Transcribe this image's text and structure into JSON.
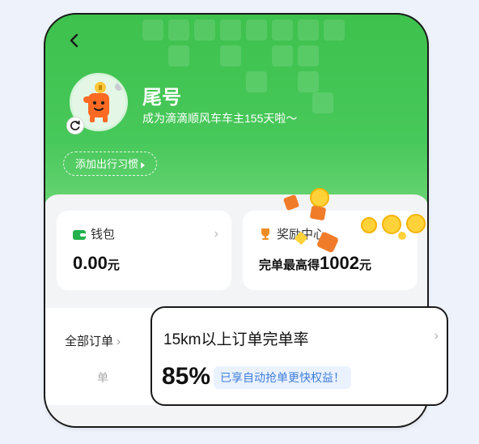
{
  "header": {
    "name": "尾号",
    "subtitle": "成为滴滴顺风车车主155天啦～",
    "habit_button": "添加出行习惯"
  },
  "wallet": {
    "title": "钱包",
    "amount": "0.00",
    "unit": "元"
  },
  "reward": {
    "title": "奖励中心",
    "prefix": "完单最高得",
    "amount": "1002",
    "unit": "元"
  },
  "orders": {
    "label": "全部订单",
    "faded_text": "单"
  },
  "popup": {
    "title": "15km以上订单完单率",
    "rate": "85%",
    "badge": "已享自动抢单更快权益！"
  },
  "colors": {
    "brand_green": "#3ec14d",
    "accent_blue": "#3f7ed8",
    "reward_orange": "#f08c26"
  }
}
